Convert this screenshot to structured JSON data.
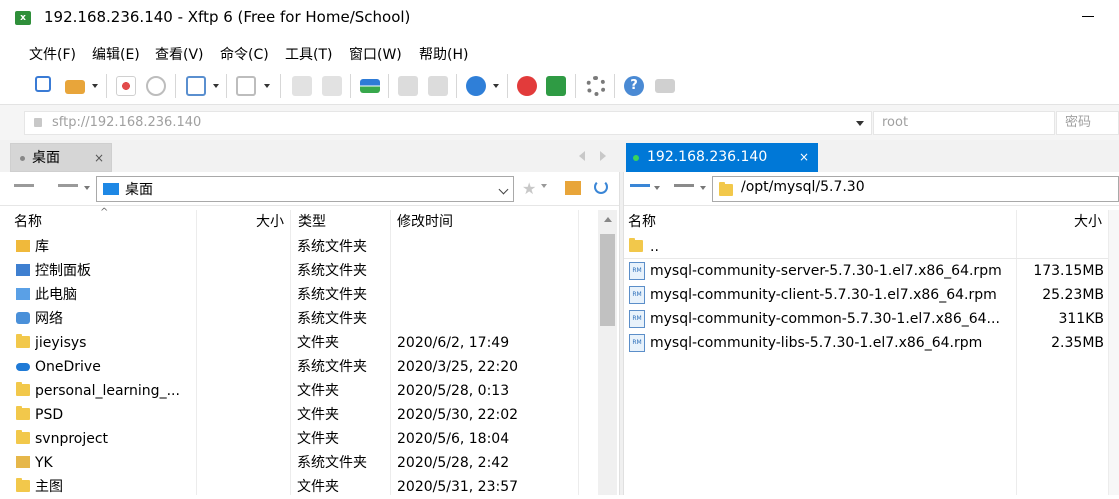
{
  "window": {
    "title": "192.168.236.140 - Xftp 6 (Free for Home/School)",
    "app_icon_text": "x"
  },
  "menu": [
    "文件(F)",
    "编辑(E)",
    "查看(V)",
    "命令(C)",
    "工具(T)",
    "窗口(W)",
    "帮助(H)"
  ],
  "toolbar": {
    "icons": [
      "new-session-icon",
      "open-folder-icon",
      "disconnect-icon",
      "reconnect-icon",
      "new-window-icon",
      "transfer-icon",
      "properties-icon",
      "sync-icon",
      "copy-icon",
      "paste-icon",
      "globe-icon",
      "xshell-icon",
      "xftp-icon",
      "settings-icon",
      "help-icon",
      "chat-icon"
    ]
  },
  "address": {
    "host_value": "sftp://192.168.236.140",
    "user_placeholder": "root",
    "password_placeholder": "密码"
  },
  "tabs": {
    "local": {
      "label": "桌面",
      "close": "×"
    },
    "remote": {
      "label": "192.168.236.140",
      "close": "×"
    }
  },
  "local": {
    "path": "桌面",
    "columns": [
      "名称",
      "大小",
      "类型",
      "修改时间"
    ],
    "rows": [
      {
        "icon": "library-icon",
        "name": "库",
        "size": "",
        "type": "系统文件夹",
        "modified": ""
      },
      {
        "icon": "control-panel-icon",
        "name": "控制面板",
        "size": "",
        "type": "系统文件夹",
        "modified": ""
      },
      {
        "icon": "computer-icon",
        "name": "此电脑",
        "size": "",
        "type": "系统文件夹",
        "modified": ""
      },
      {
        "icon": "network-icon",
        "name": "网络",
        "size": "",
        "type": "系统文件夹",
        "modified": ""
      },
      {
        "icon": "folder-icon",
        "name": "jieyisys",
        "size": "",
        "type": "文件夹",
        "modified": "2020/6/2, 17:49"
      },
      {
        "icon": "onedrive-icon",
        "name": "OneDrive",
        "size": "",
        "type": "系统文件夹",
        "modified": "2020/3/25, 22:20"
      },
      {
        "icon": "folder-icon",
        "name": "personal_learning_...",
        "size": "",
        "type": "文件夹",
        "modified": "2020/5/28, 0:13"
      },
      {
        "icon": "folder-icon",
        "name": "PSD",
        "size": "",
        "type": "文件夹",
        "modified": "2020/5/30, 22:02"
      },
      {
        "icon": "folder-icon",
        "name": "svnproject",
        "size": "",
        "type": "文件夹",
        "modified": "2020/5/6, 18:04"
      },
      {
        "icon": "user-folder-icon",
        "name": "YK",
        "size": "",
        "type": "系统文件夹",
        "modified": "2020/5/28, 2:42"
      },
      {
        "icon": "folder-icon",
        "name": "主图",
        "size": "",
        "type": "文件夹",
        "modified": "2020/5/31, 23:57"
      }
    ]
  },
  "remote": {
    "path": "/opt/mysql/5.7.30",
    "columns": [
      "名称",
      "大小"
    ],
    "rows": [
      {
        "icon": "folder-icon",
        "name": "..",
        "size": ""
      },
      {
        "icon": "rpm-icon",
        "name": "mysql-community-server-5.7.30-1.el7.x86_64.rpm",
        "size": "173.15MB"
      },
      {
        "icon": "rpm-icon",
        "name": "mysql-community-client-5.7.30-1.el7.x86_64.rpm",
        "size": "25.23MB"
      },
      {
        "icon": "rpm-icon",
        "name": "mysql-community-common-5.7.30-1.el7.x86_64...",
        "size": "311KB"
      },
      {
        "icon": "rpm-icon",
        "name": "mysql-community-libs-5.7.30-1.el7.x86_64.rpm",
        "size": "2.35MB"
      }
    ]
  },
  "colors": {
    "accent": "#0078d7",
    "tab_active": "#0078d7"
  }
}
